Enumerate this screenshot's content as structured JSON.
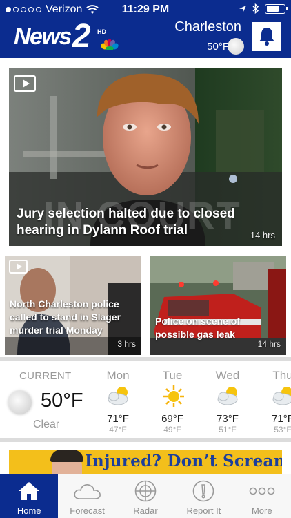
{
  "status_bar": {
    "carrier": "Verizon",
    "time": "11:29 PM",
    "battery_level": 0.7
  },
  "header": {
    "logo_word": "News",
    "logo_number": "2",
    "logo_hd": "HD",
    "city": "Charleston",
    "temperature": "50°F",
    "icons": {
      "weather": "moon-icon",
      "alerts": "bell-icon"
    }
  },
  "hero": {
    "headline": "Jury selection halted due to closed hearing in Dylann Roof trial",
    "age": "14 hrs",
    "overlay_text": "IN COURT",
    "has_video": true
  },
  "stories": [
    {
      "headline": "North Charleston police called to stand in Slager murder trial Monday",
      "age": "3 hrs",
      "has_video": true
    },
    {
      "headline": "Police on scene of possible gas leak",
      "age": "14 hrs",
      "has_video": false
    }
  ],
  "weather": {
    "current_label": "CURRENT",
    "current_temp": "50°F",
    "current_condition": "Clear",
    "forecast": [
      {
        "day": "Mon",
        "high": "71°F",
        "low": "47°F",
        "icon": "partly-cloudy-icon"
      },
      {
        "day": "Tue",
        "high": "69°F",
        "low": "49°F",
        "icon": "sunny-icon"
      },
      {
        "day": "Wed",
        "high": "73°F",
        "low": "51°F",
        "icon": "partly-cloudy-icon"
      },
      {
        "day": "Thu",
        "high": "71°F",
        "low": "53°F",
        "icon": "partly-cloudy-icon"
      }
    ]
  },
  "ad": {
    "text": "Injured? Don’t Scream"
  },
  "tabs": [
    {
      "label": "Home",
      "icon": "home-icon",
      "active": true
    },
    {
      "label": "Forecast",
      "icon": "cloud-icon",
      "active": false
    },
    {
      "label": "Radar",
      "icon": "radar-icon",
      "active": false
    },
    {
      "label": "Report It",
      "icon": "alert-icon",
      "active": false
    },
    {
      "label": "More",
      "icon": "more-icon",
      "active": false
    }
  ],
  "colors": {
    "brand_blue": "#0b2c8f",
    "ad_yellow": "#f3bf1b",
    "ad_text": "#1d3f9b"
  }
}
